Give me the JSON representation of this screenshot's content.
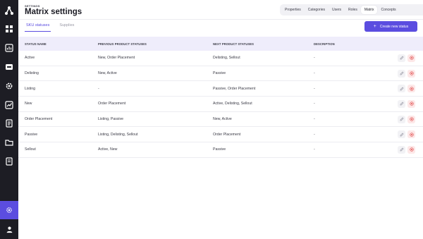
{
  "header": {
    "breadcrumb": "SETTINGS",
    "title": "Matrix settings"
  },
  "top_tabs": [
    {
      "label": "Properties",
      "active": false
    },
    {
      "label": "Categories",
      "active": false
    },
    {
      "label": "Users",
      "active": false
    },
    {
      "label": "Roles",
      "active": false
    },
    {
      "label": "Matrix",
      "active": true
    },
    {
      "label": "Concepts",
      "active": false
    }
  ],
  "sub_tabs": [
    {
      "label": "SKU statuses",
      "active": true
    },
    {
      "label": "Supplies",
      "active": false
    }
  ],
  "create_button": {
    "label": "Create new status",
    "icon": "plus-icon"
  },
  "table": {
    "columns": [
      "STATUS NAME",
      "PREVIOUS PRODUCT STATUSES",
      "NEXT PRODUCT STATUSES",
      "DESCRIPTION"
    ],
    "rows": [
      {
        "name": "Active",
        "previous": "New, Order Placement",
        "next": "Delisting, Sellout",
        "description": "-"
      },
      {
        "name": "Delisting",
        "previous": "New, Active",
        "next": "Passive",
        "description": "-"
      },
      {
        "name": "Listing",
        "previous": "-",
        "next": "Passive, Order Placement",
        "description": "-"
      },
      {
        "name": "New",
        "previous": "Order Placement",
        "next": "Active, Delisting, Sellout",
        "description": "-"
      },
      {
        "name": "Order Placement",
        "previous": "Listing, Passive",
        "next": "New, Active",
        "description": "-"
      },
      {
        "name": "Passive",
        "previous": "Listing, Delisting, Sellout",
        "next": "Order Placement",
        "description": "-"
      },
      {
        "name": "Sellout",
        "previous": "Active, New",
        "next": "Passive",
        "description": "-"
      }
    ]
  },
  "colors": {
    "accent": "#5b4de0",
    "sidebar": "#1d1d24",
    "table_header": "#efedfb",
    "delete": "#e04b4b"
  }
}
